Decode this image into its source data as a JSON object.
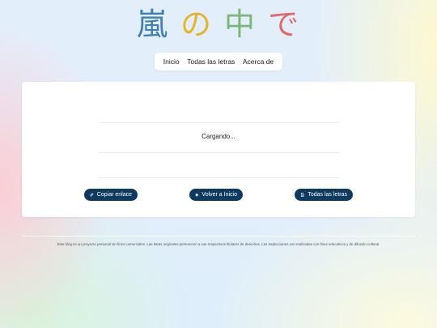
{
  "logo": {
    "chars": [
      "嵐",
      "の",
      "中",
      "で"
    ],
    "colors": [
      "#3f7fb6",
      "#e5b532",
      "#7bb77a",
      "#e06a6a"
    ]
  },
  "nav": {
    "items": [
      "Inicio",
      "Todas las letras",
      "Acerca de"
    ]
  },
  "main": {
    "loading_text": "Cargando...",
    "buttons": {
      "copy_label": "Copiar enlace",
      "home_label": "Volver a Inicio",
      "all_label": "Todas las letras"
    },
    "button_color": "#0f3a5f"
  },
  "footer": {
    "text": "Este blog es un proyecto personal sin fines comerciales. Las letras originales pertenecen a sus respectivos titulares de derechos. Las traducciones son realizadas con fines educativos y de difusión cultural."
  }
}
